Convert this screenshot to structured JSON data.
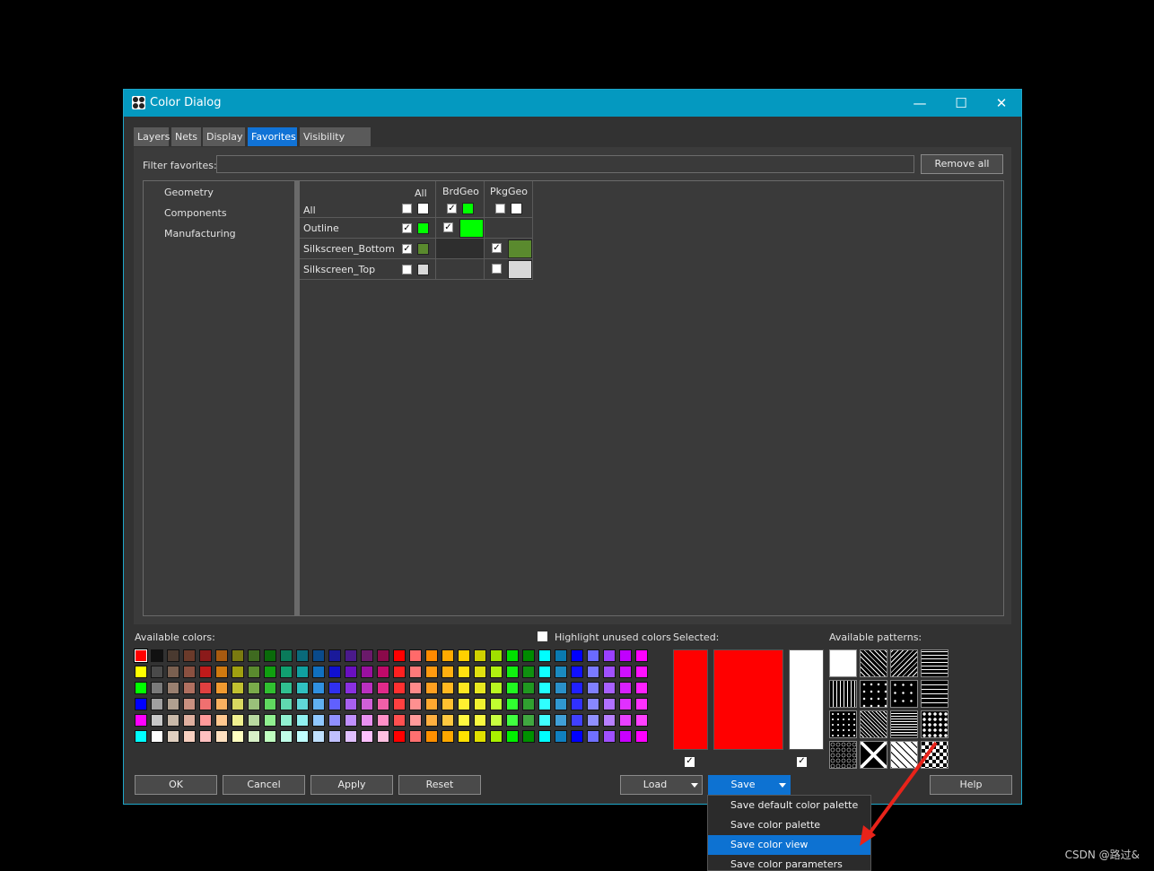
{
  "window": {
    "title": "Color Dialog",
    "controls": {
      "minimize": "—",
      "maximize": "☐",
      "close": "✕"
    }
  },
  "tabs": [
    {
      "label": "Layers",
      "active": false
    },
    {
      "label": "Nets",
      "active": false
    },
    {
      "label": "Display",
      "active": false
    },
    {
      "label": "Favorites",
      "active": true
    },
    {
      "label": "Visibility Pane",
      "active": false
    }
  ],
  "filter": {
    "label": "Filter favorites:",
    "value": "",
    "remove_all_label": "Remove all"
  },
  "tree": [
    "Geometry",
    "Components",
    "Manufacturing"
  ],
  "grid": {
    "col_all": "All",
    "col_brdgeo": "BrdGeo",
    "col_pkggeo": "PkgGeo",
    "rows": [
      {
        "label": "All"
      },
      {
        "label": "Outline"
      },
      {
        "label": "Silkscreen_Bottom"
      },
      {
        "label": "Silkscreen_Top"
      }
    ]
  },
  "colors": {
    "green": "#00ff00",
    "olive": "#5a8a2e",
    "lightgray": "#d8d8d8",
    "selected": "#ff0000"
  },
  "available_colors_label": "Available colors:",
  "highlight_unused_label": "Highlight unused colors",
  "selected_label": "Selected:",
  "available_patterns_label": "Available patterns:",
  "buttons": {
    "ok": "OK",
    "cancel": "Cancel",
    "apply": "Apply",
    "reset": "Reset",
    "load": "Load",
    "save": "Save",
    "help": "Help"
  },
  "save_menu": [
    "Save default color palette",
    "Save color palette",
    "Save color view",
    "Save color parameters"
  ],
  "watermark": "CSDN @路过&"
}
